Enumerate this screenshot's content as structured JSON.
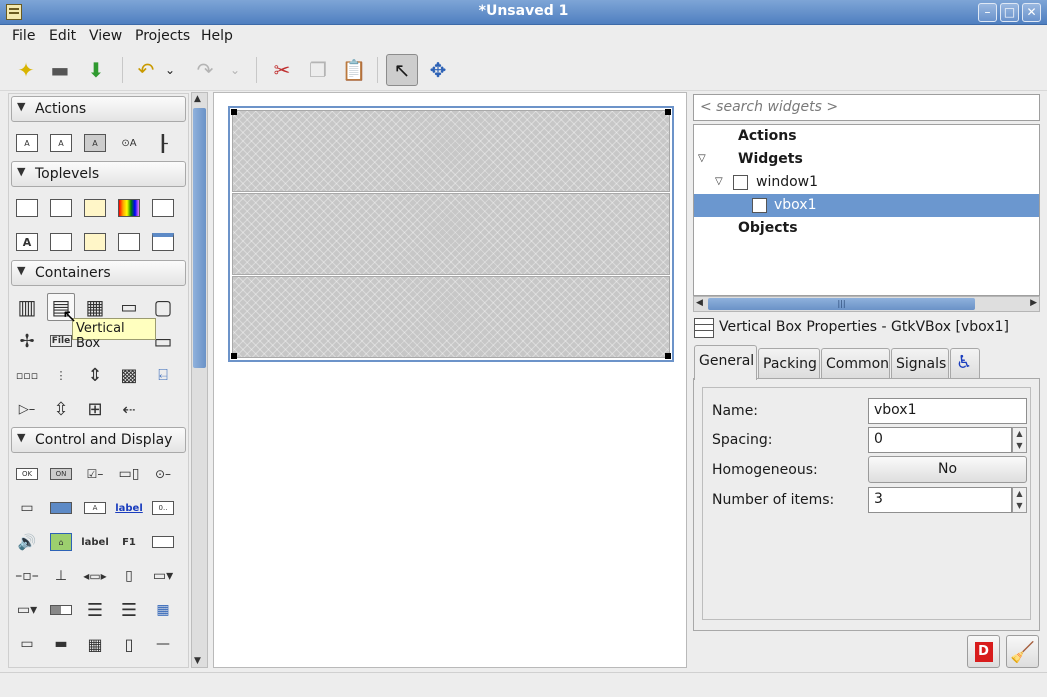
{
  "window": {
    "title": "*Unsaved 1"
  },
  "menubar": {
    "items": [
      "File",
      "Edit",
      "View",
      "Projects",
      "Help"
    ]
  },
  "palette": {
    "groups": [
      {
        "label": "Actions"
      },
      {
        "label": "Toplevels"
      },
      {
        "label": "Containers"
      },
      {
        "label": "Control and Display"
      }
    ],
    "icon_text": {
      "a1": "A",
      "a2": "A",
      "a3": "A",
      "a4": "⊙A",
      "tl_label": "A",
      "file": "File",
      "ok": "OK",
      "on": "ON",
      "cd_a": "A",
      "label_link": "label",
      "spin": "0..",
      "label_plain": "label",
      "f1": "F1"
    },
    "tooltip": "Vertical Box"
  },
  "tree": {
    "search_placeholder": "< search widgets >",
    "rows": [
      {
        "label": "Actions"
      },
      {
        "label": "Widgets"
      },
      {
        "label": "window1"
      },
      {
        "label": "vbox1"
      },
      {
        "label": "Objects"
      }
    ]
  },
  "properties": {
    "header": "Vertical Box Properties - GtkVBox [vbox1]",
    "tabs": [
      "General",
      "Packing",
      "Common",
      "Signals"
    ],
    "fields": {
      "name_label": "Name:",
      "name_value": "vbox1",
      "spacing_label": "Spacing:",
      "spacing_value": "0",
      "homogeneous_label": "Homogeneous:",
      "homogeneous_value": "No",
      "items_label": "Number of items:",
      "items_value": "3"
    }
  },
  "design": {
    "vbox_cells": 3
  },
  "colors": {
    "selection": "#6b97cf",
    "titlebar": "#5d8ac6",
    "tooltip_bg": "#ffffbf"
  }
}
